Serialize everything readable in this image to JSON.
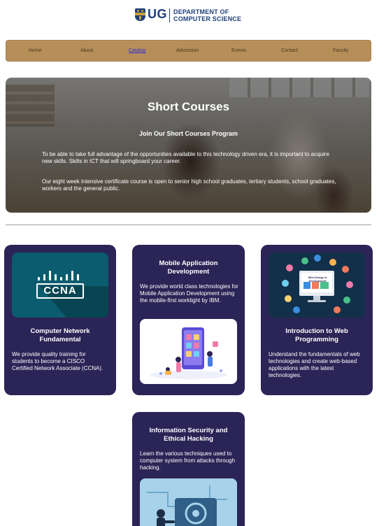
{
  "header": {
    "logo_text": "UG",
    "dept_line1": "DEPARTMENT OF",
    "dept_line2": "COMPUTER SCIENCE"
  },
  "nav": {
    "items": [
      {
        "label": "Home"
      },
      {
        "label": "About"
      },
      {
        "label": "Catalog"
      },
      {
        "label": "Admission"
      },
      {
        "label": "Events"
      },
      {
        "label": "Contact"
      },
      {
        "label": "Faculty"
      }
    ],
    "active": "Catalog"
  },
  "hero": {
    "title": "Short Courses",
    "subtitle": "Join Our Short Courses Program",
    "paragraph1": "To be able to take full advantage of the opportunities available to this technology driven era, it is important to acquire new skills. Skills in ICT that will springboard your career.",
    "paragraph2": "Our eight week intensive certificate course is open to senior high school graduates, tertiary students, school graduates, workers and the general public."
  },
  "courses": [
    {
      "title": "Computer Network Fundamental",
      "description": "We provide quality training for students to become a CISCO Certified Network Associate (CCNA).",
      "image_text": "CCNA"
    },
    {
      "title": "Mobile Application Development",
      "description": "We provide world class technologies for Mobile Application Development using the mobile-first worklight by IBM."
    },
    {
      "title": "Introduction to Web Programming",
      "description": "Understand the fundamentals of web technologies and create web-based applications with the latest technologies.",
      "image_text": "Web Design & Development"
    },
    {
      "title": "Information Security and Ethical Hacking",
      "description": "Learn the various techniques used to computer system from attacks through hacking."
    }
  ],
  "colors": {
    "nav_bg": "#b68e58",
    "card_bg": "#2b2456",
    "brand_blue": "#1f3f7a"
  }
}
